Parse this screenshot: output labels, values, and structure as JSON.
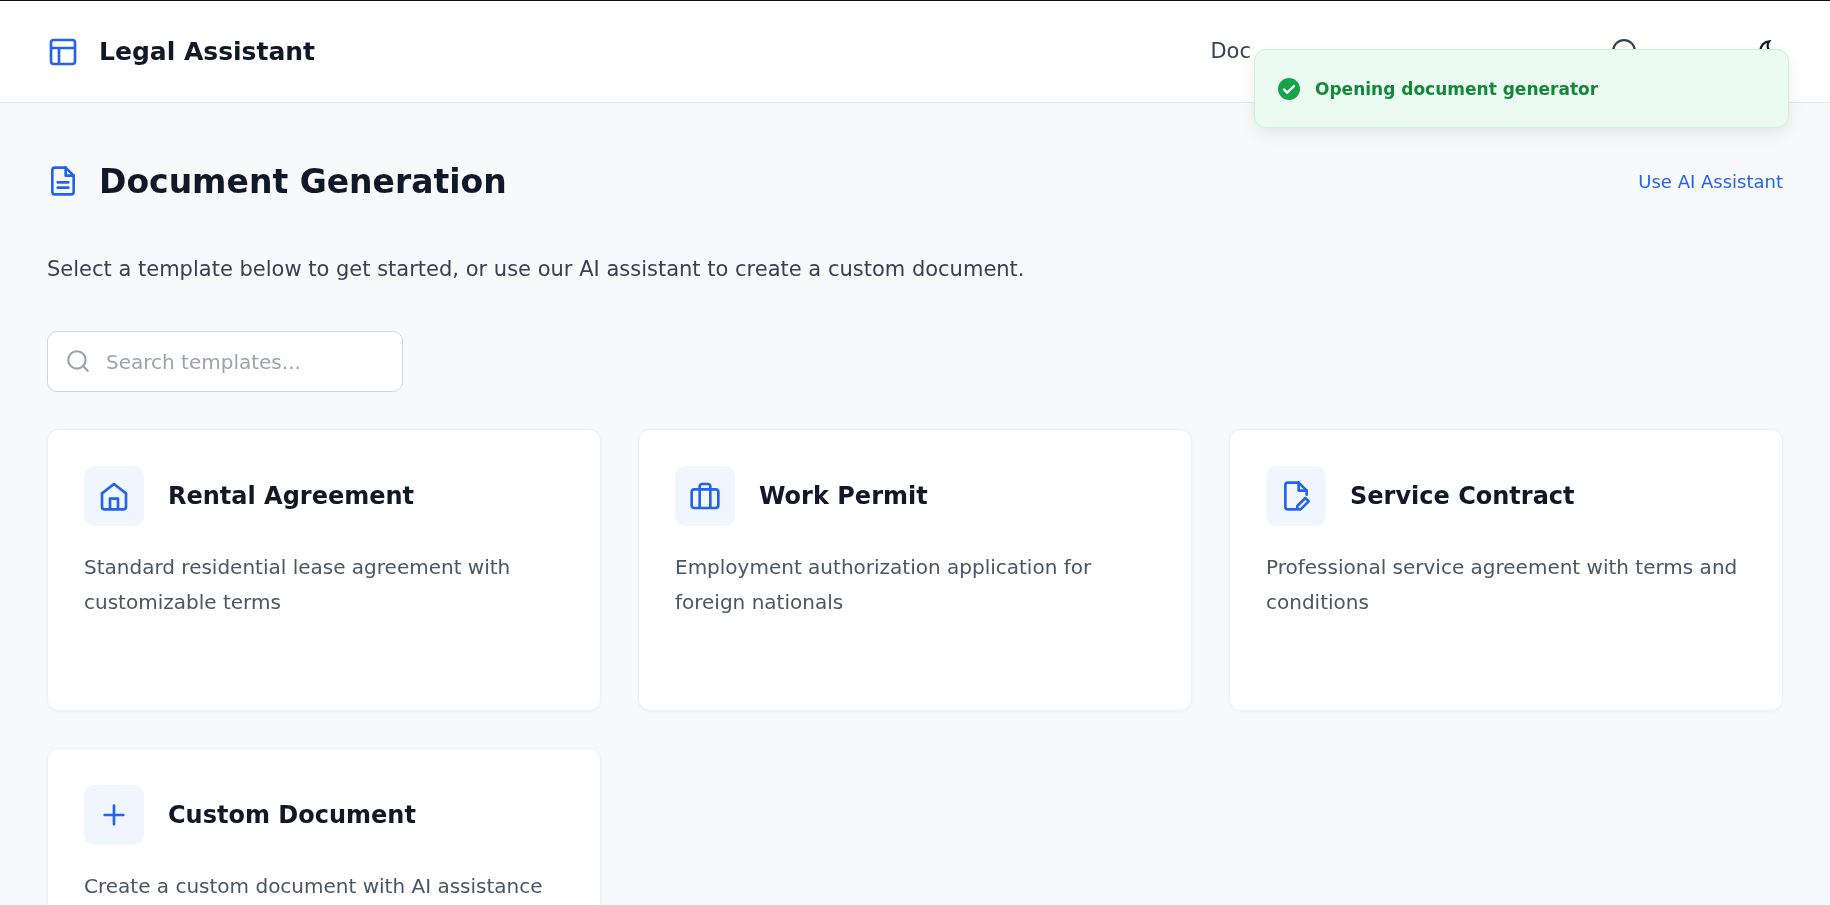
{
  "header": {
    "title": "Legal Assistant",
    "nav": [
      {
        "label": "Doc"
      }
    ]
  },
  "toast": {
    "kind": "success",
    "message": "Opening document generator"
  },
  "page": {
    "title": "Document Generation",
    "action": "Use AI Assistant",
    "description": "Select a template below to get started, or use our AI assistant to create a custom document."
  },
  "search": {
    "placeholder": "Search templates..."
  },
  "templates": [
    {
      "kind": "house",
      "title": "Rental Agreement",
      "description": "Standard residential lease agreement with customizable terms"
    },
    {
      "kind": "briefcase",
      "title": "Work Permit",
      "description": "Employment authorization application for foreign nationals"
    },
    {
      "kind": "edit",
      "title": "Service Contract",
      "description": "Professional service agreement with terms and conditions"
    },
    {
      "kind": "plus",
      "title": "Custom Document",
      "description": "Create a custom document with AI assistance"
    }
  ]
}
